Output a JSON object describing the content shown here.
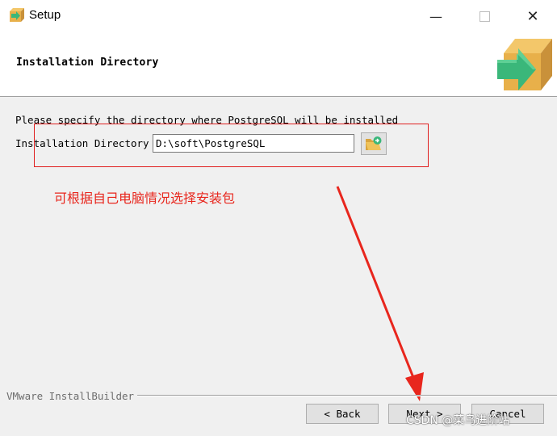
{
  "window": {
    "title": "Setup",
    "minimize_glyph": "—",
    "close_glyph": "✕"
  },
  "header": {
    "title": "Installation Directory",
    "logo_icon": "installer-box-arrow-icon"
  },
  "main": {
    "instruction": "Please specify the directory where PostgreSQL will be installed",
    "directory_label": "Installation Directory",
    "directory_value": "D:\\soft\\PostgreSQL",
    "browse_icon": "folder-browse-icon"
  },
  "annotation": {
    "text": "可根据自己电脑情况选择安装包",
    "color": "#e8261d"
  },
  "footer": {
    "brand": "VMware InstallBuilder",
    "back_label": "< Back",
    "next_label": "Next >",
    "cancel_label": "Cancel"
  },
  "watermark": "CSDN @菜鸟进阶站",
  "colors": {
    "background": "#f0f0f0",
    "header_background": "#ffffff",
    "highlight": "#e02020",
    "logo_green": "#3ab77a",
    "logo_box": "#e8b04a"
  }
}
